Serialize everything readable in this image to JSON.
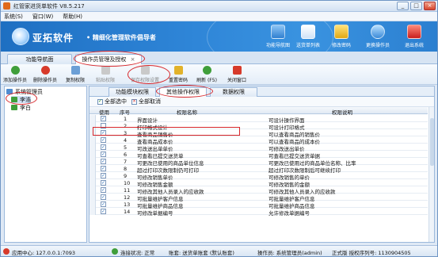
{
  "window": {
    "title": "红管家进货单软件 V8.5.217",
    "btn_min": "_",
    "btn_max": "□",
    "btn_close": "×"
  },
  "menu": [
    "系统(S)",
    "窗口(W)",
    "帮助(H)"
  ],
  "banner": {
    "brand": "亚拓软件",
    "slogan": "• 精细化管理软件倡导者",
    "buttons": [
      "功能导航图",
      "送货单列表",
      "修改密码",
      "更换操作员",
      "退出系统"
    ]
  },
  "tabs": {
    "nav": "功能导航面",
    "active": "操作员管理及授权",
    "close": "×"
  },
  "toolbar": [
    "添加操作员",
    "删除操作员",
    "复制权限",
    "粘贴权限",
    "保存权限设置",
    "重置密码",
    "刷新 (F5)",
    "关闭窗口"
  ],
  "left_tree": {
    "root": "系统管理员",
    "items": [
      "李浩",
      "李白"
    ]
  },
  "subtabs": [
    "功能模块权限",
    "其他操作权限",
    "数据权限"
  ],
  "selbar": {
    "select_all": "全部选中",
    "cancel_all": "全部取消"
  },
  "grid": {
    "headers": [
      "使用",
      "序号",
      "权限名称",
      "权限说明"
    ],
    "rows": [
      {
        "checked": true,
        "no": "1",
        "name": "界面设计",
        "desc": "可设计操作界面"
      },
      {
        "checked": false,
        "no": "2",
        "name": "打印格式设计",
        "desc": "可设计打印格式"
      },
      {
        "checked": true,
        "no": "3",
        "name": "查看商品销售价",
        "desc": "可以查看商品的销售价"
      },
      {
        "checked": true,
        "no": "4",
        "name": "查看商品成本价",
        "desc": "可以查看商品的成本价"
      },
      {
        "checked": true,
        "no": "5",
        "name": "可改送出单单价",
        "desc": "可修改送出单价"
      },
      {
        "checked": true,
        "no": "6",
        "name": "可查看已提交送货单",
        "desc": "可查看已提交送货单据"
      },
      {
        "checked": true,
        "no": "7",
        "name": "可更改已使用的商品单位信息",
        "desc": "可更改已使用过的商品单位名称、比率"
      },
      {
        "checked": true,
        "no": "8",
        "name": "超过打印次数限制仍可打印",
        "desc": "超过打印次数限制后可继续打印"
      },
      {
        "checked": true,
        "no": "9",
        "name": "可修改销售单价",
        "desc": "可修改销售的单价"
      },
      {
        "checked": true,
        "no": "10",
        "name": "可修改销售金额",
        "desc": "可修改销售的金额"
      },
      {
        "checked": true,
        "no": "11",
        "name": "可修改其他人员录入的应收款",
        "desc": "可修改其他人员录入的应收款"
      },
      {
        "checked": true,
        "no": "12",
        "name": "可批量维护客户信息",
        "desc": "可批量维护客户信息"
      },
      {
        "checked": true,
        "no": "13",
        "name": "可批量维护商品信息",
        "desc": "可批量维护商品信息"
      },
      {
        "checked": true,
        "no": "14",
        "name": "可修改单据编号",
        "desc": "允许修改单据编号"
      }
    ]
  },
  "status": {
    "center": "应用中心: 127.0.0.1:7093",
    "conn": "连接状况: 正常",
    "account": "账套: 送货单账套 (默认账套)",
    "operator": "操作员: 系统管理员(admin)",
    "version": "正式版 授权序列号: 1130904505"
  }
}
